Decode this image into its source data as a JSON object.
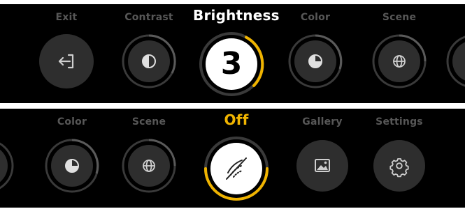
{
  "top_row": {
    "items": [
      {
        "id": "exit",
        "label": "Exit",
        "icon": "exit-icon"
      },
      {
        "id": "contrast",
        "label": "Contrast",
        "icon": "contrast-icon",
        "level": 0.55
      },
      {
        "id": "brightness",
        "label": "Brightness",
        "icon": "none",
        "value": "3",
        "active": true,
        "level": 0.35
      },
      {
        "id": "color",
        "label": "Color",
        "icon": "color-icon",
        "level": 0.45
      },
      {
        "id": "scene",
        "label": "Scene",
        "icon": "globe-icon",
        "level": 0.5
      }
    ]
  },
  "bottom_row": {
    "items": [
      {
        "id": "color",
        "label": "Color",
        "icon": "color-icon",
        "level": 0.45
      },
      {
        "id": "scene",
        "label": "Scene",
        "icon": "globe-icon",
        "level": 0.5
      },
      {
        "id": "off",
        "label": "Off",
        "icon": "hdr-off-icon",
        "active": true,
        "level": 0.5
      },
      {
        "id": "gallery",
        "label": "Gallery",
        "icon": "image-icon"
      },
      {
        "id": "settings",
        "label": "Settings",
        "icon": "gear-icon"
      }
    ]
  },
  "colors": {
    "background": "#000000",
    "accent": "#f0b400",
    "inactive_label": "#575757",
    "inactive_circle": "#2e2e2e",
    "ring_track": "#3a3a3a",
    "ring_fill": "#5a5a5a"
  }
}
